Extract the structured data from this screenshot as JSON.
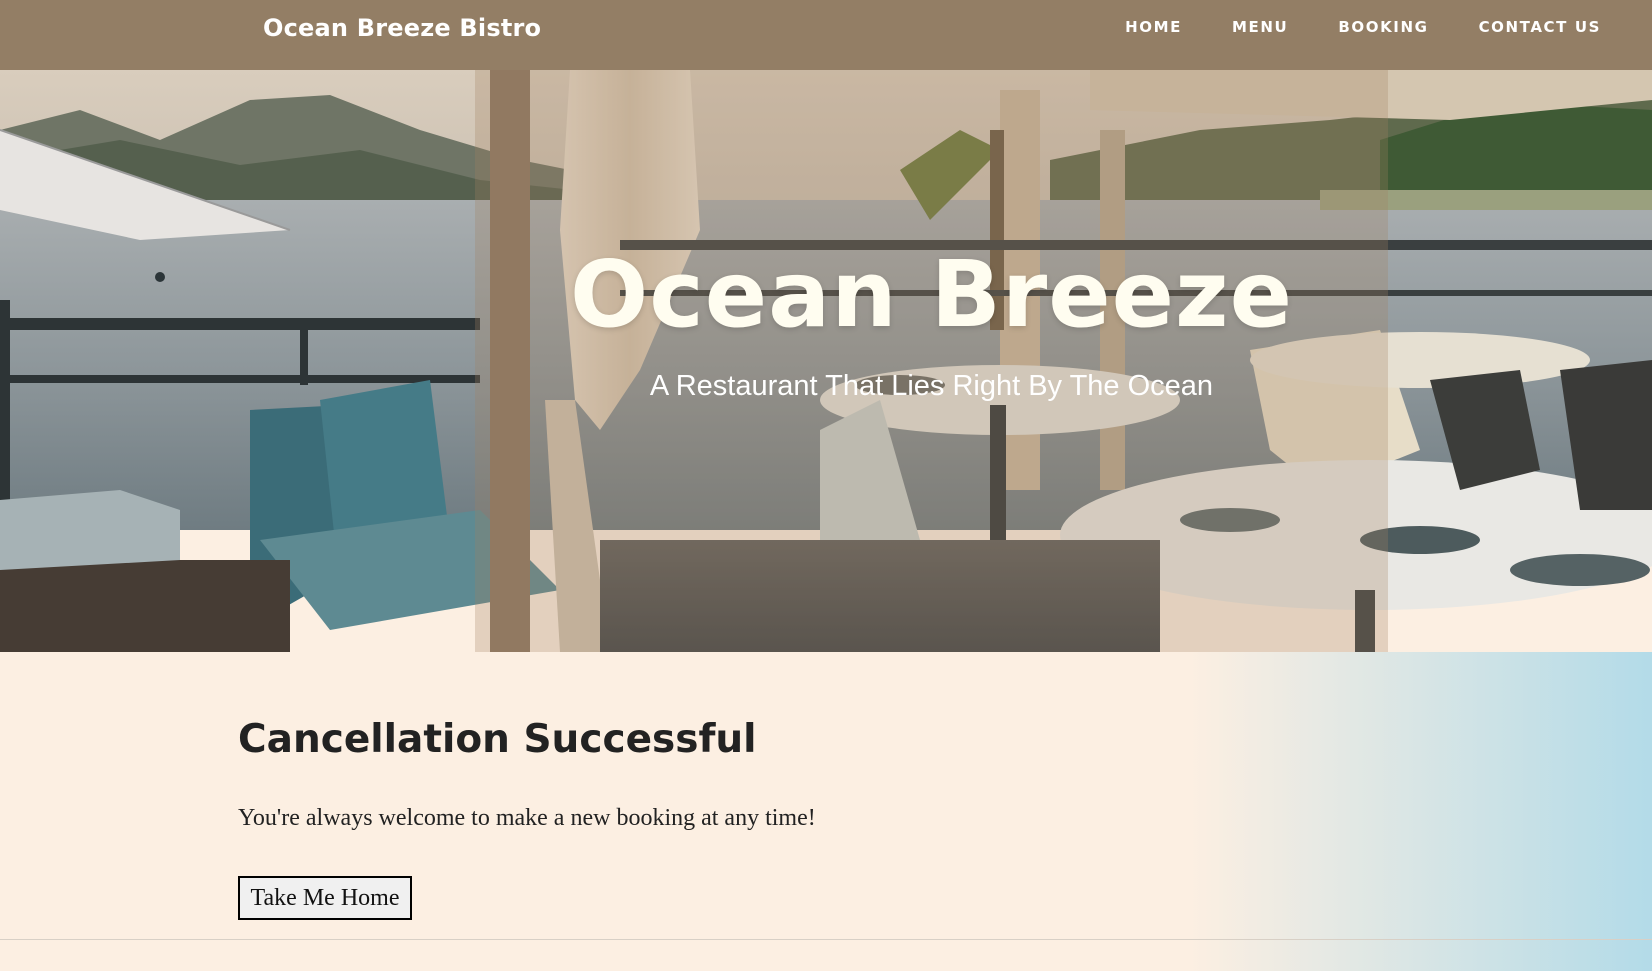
{
  "navbar": {
    "brand": "Ocean Breeze Bistro",
    "links": [
      {
        "label": "HOME"
      },
      {
        "label": "MENU"
      },
      {
        "label": "BOOKING"
      },
      {
        "label": "CONTACT US"
      }
    ]
  },
  "hero": {
    "title": "Ocean Breeze",
    "subtitle": "A Restaurant That Lies Right By The Ocean",
    "image": "seaside-restaurant-terrace-photo"
  },
  "content": {
    "heading": "Cancellation Successful",
    "message": "You're always welcome to make a new booking at any time!",
    "button_label": "Take Me Home"
  },
  "colors": {
    "navbar_bg": "#937e65",
    "page_bg": "#fcefe2",
    "gradient_end": "#b3dbe8",
    "hero_title": "#fffdf0",
    "text_dark": "#222222"
  }
}
